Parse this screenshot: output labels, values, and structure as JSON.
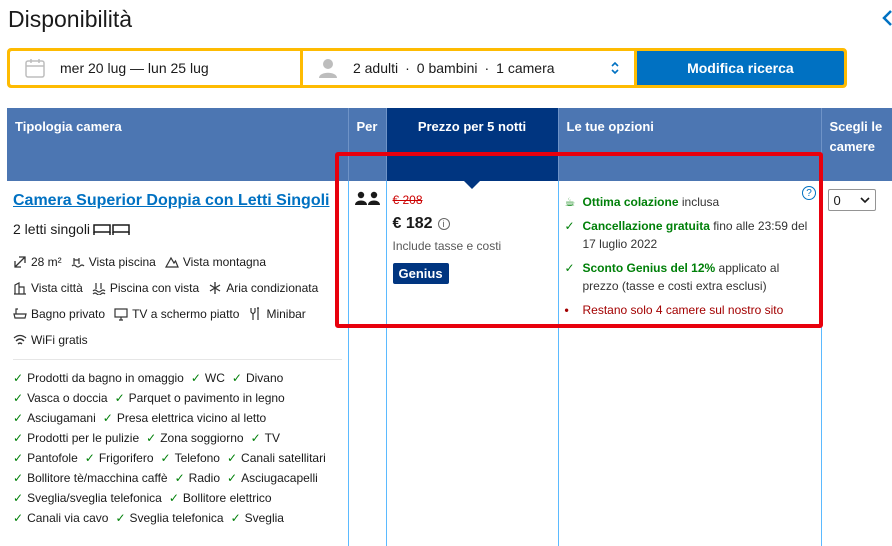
{
  "page": {
    "title": "Disponibilità"
  },
  "search": {
    "dates": "mer 20 lug — lun 25 lug",
    "adults": "2 adulti",
    "children": "0 bambini",
    "rooms": "1 camera",
    "separator": "·",
    "button": "Modifica ricerca"
  },
  "table": {
    "headers": {
      "room_type": "Tipologia camera",
      "per": "Per",
      "price": "Prezzo per 5 notti",
      "options": "Le tue opzioni",
      "choose": "Scegli le camere"
    },
    "room": {
      "name": "Camera Superior Doppia con Letti Singoli",
      "beds": "2 letti singoli",
      "facilities": [
        {
          "icon": "size-icon",
          "label": "28 m²"
        },
        {
          "icon": "pool-view-icon",
          "label": "Vista piscina"
        },
        {
          "icon": "mountain-icon",
          "label": "Vista montagna"
        },
        {
          "icon": "city-icon",
          "label": "Vista città"
        },
        {
          "icon": "pool-icon",
          "label": "Piscina con vista"
        },
        {
          "icon": "snowflake-icon",
          "label": "Aria condizionata"
        },
        {
          "icon": "bath-icon",
          "label": "Bagno privato"
        },
        {
          "icon": "tv-icon",
          "label": "TV a schermo piatto"
        },
        {
          "icon": "minibar-icon",
          "label": "Minibar"
        },
        {
          "icon": "wifi-icon",
          "label": "WiFi gratis"
        }
      ],
      "amenities": [
        "Prodotti da bagno in omaggio",
        "WC",
        "Divano",
        "Vasca o doccia",
        "Parquet o pavimento in legno",
        "Asciugamani",
        "Presa elettrica vicino al letto",
        "Prodotti per le pulizie",
        "Zona soggiorno",
        "TV",
        "Pantofole",
        "Frigorifero",
        "Telefono",
        "Canali satellitari",
        "Bollitore tè/macchina caffè",
        "Radio",
        "Asciugacapelli",
        "Sveglia/sveglia telefonica",
        "Bollitore elettrico",
        "Canali via cavo",
        "Sveglia telefonica",
        "Sveglia"
      ]
    },
    "price": {
      "old": "€ 208",
      "current": "€ 182",
      "info": "i",
      "note": "Include tasse e costi",
      "badge": "Genius"
    },
    "options": {
      "breakfast_bold": "Ottima colazione",
      "breakfast_rest": " inclusa",
      "cancel_bold": "Cancellazione gratuita",
      "cancel_rest": " fino alle 23:59 del 17 luglio 2022",
      "genius_bold": "Sconto Genius del 12%",
      "genius_rest": " applicato al prezzo (tasse e costi extra esclusi)",
      "scarcity": "Restano solo 4 camere sul nostro sito",
      "help": "?"
    },
    "select": {
      "value": "0"
    }
  },
  "colors": {
    "header_bg": "#4c76b2",
    "price_header_bg": "#003580",
    "accent": "#0071c2",
    "search_border": "#febb02",
    "highlight": "#e8000d",
    "green": "#008009",
    "red": "#cc0000"
  }
}
